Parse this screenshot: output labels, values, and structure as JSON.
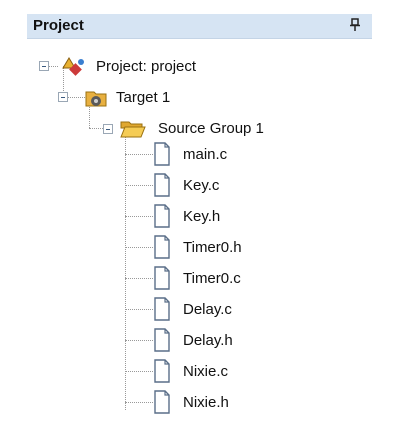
{
  "panel": {
    "title": "Project"
  },
  "tree": {
    "root": {
      "label": "Project: project",
      "icon": "project-icon",
      "expanded": true
    },
    "target": {
      "label": "Target 1",
      "icon": "target-icon",
      "expanded": true
    },
    "group": {
      "label": "Source Group 1",
      "icon": "folder-open-icon",
      "expanded": true
    },
    "files": [
      {
        "label": "main.c",
        "icon": "file-icon"
      },
      {
        "label": "Key.c",
        "icon": "file-icon"
      },
      {
        "label": "Key.h",
        "icon": "file-icon"
      },
      {
        "label": "Timer0.h",
        "icon": "file-icon"
      },
      {
        "label": "Timer0.c",
        "icon": "file-icon"
      },
      {
        "label": "Delay.c",
        "icon": "file-icon"
      },
      {
        "label": "Delay.h",
        "icon": "file-icon"
      },
      {
        "label": "Nixie.c",
        "icon": "file-icon"
      },
      {
        "label": "Nixie.h",
        "icon": "file-icon"
      }
    ]
  },
  "colors": {
    "header_bg": "#d6e4f3",
    "folder": "#f0c040",
    "file_outline": "#5a6e88"
  }
}
